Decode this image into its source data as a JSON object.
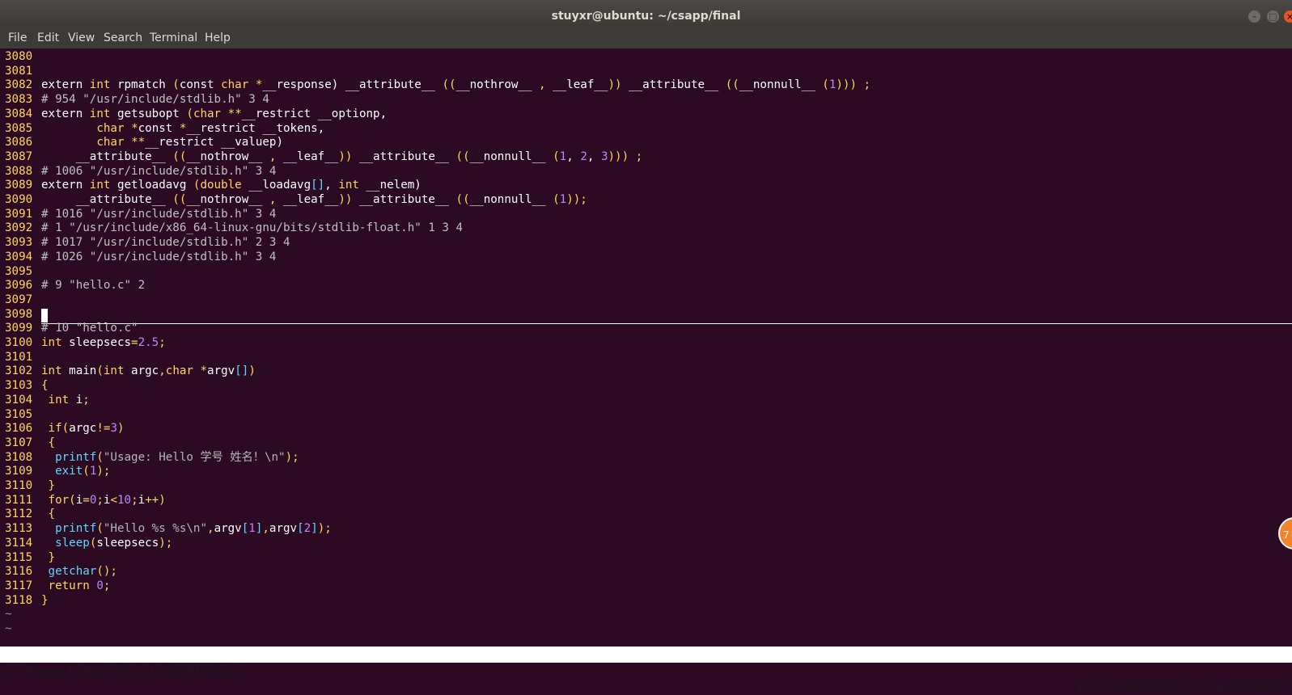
{
  "window": {
    "title": "stuyxr@ubuntu: ~/csapp/final",
    "buttons": {
      "minimize": "–",
      "maximize": "□",
      "close": "×"
    }
  },
  "menu": [
    "File",
    "Edit",
    "View",
    "Search",
    "Terminal",
    "Help"
  ],
  "editor": {
    "lines": [
      {
        "n": "3080",
        "t": []
      },
      {
        "n": "3081",
        "t": []
      },
      {
        "n": "3082",
        "t": [
          [
            "extern "
          ],
          [
            "int",
            "kw"
          ],
          [
            " rpmatch "
          ],
          [
            "(",
            "br"
          ],
          [
            "const "
          ],
          [
            "char",
            "kw"
          ],
          [
            " "
          ],
          [
            "*",
            "kw"
          ],
          [
            "__response) "
          ],
          [
            "__attribute__ "
          ],
          [
            "((",
            "br"
          ],
          [
            "__nothrow__ "
          ],
          [
            ",",
            "br"
          ],
          [
            " __leaf__"
          ],
          [
            "))",
            "br"
          ],
          [
            " __attribute__ "
          ],
          [
            "((",
            "br"
          ],
          [
            "__nonnull__ "
          ],
          [
            "(",
            "br"
          ],
          [
            "1",
            "num"
          ],
          [
            ")))",
            "br"
          ],
          [
            " ;",
            "br"
          ]
        ]
      },
      {
        "n": "3083",
        "t": [
          [
            "# 954 \"/usr/include/stdlib.h\" 3 4",
            "cmt"
          ]
        ]
      },
      {
        "n": "3084",
        "t": [
          [
            "extern "
          ],
          [
            "int",
            "kw"
          ],
          [
            " getsubopt "
          ],
          [
            "(",
            "br"
          ],
          [
            "char",
            "kw"
          ],
          [
            " "
          ],
          [
            "**",
            "kw"
          ],
          [
            "__restrict __optionp,"
          ]
        ]
      },
      {
        "n": "3085",
        "t": [
          [
            "        "
          ],
          [
            "char",
            "kw"
          ],
          [
            " "
          ],
          [
            "*",
            "kw"
          ],
          [
            "const "
          ],
          [
            "*",
            "kw"
          ],
          [
            "__restrict __tokens,"
          ]
        ]
      },
      {
        "n": "3086",
        "t": [
          [
            "        "
          ],
          [
            "char",
            "kw"
          ],
          [
            " "
          ],
          [
            "**",
            "kw"
          ],
          [
            "__restrict __valuep)"
          ]
        ]
      },
      {
        "n": "3087",
        "t": [
          [
            "     __attribute__ "
          ],
          [
            "((",
            "br"
          ],
          [
            "__nothrow__ "
          ],
          [
            ",",
            "br"
          ],
          [
            " __leaf__"
          ],
          [
            "))",
            "br"
          ],
          [
            " __attribute__ "
          ],
          [
            "((",
            "br"
          ],
          [
            "__nonnull__ "
          ],
          [
            "(",
            "br"
          ],
          [
            "1",
            "num"
          ],
          [
            ", "
          ],
          [
            "2",
            "num"
          ],
          [
            ", "
          ],
          [
            "3",
            "num"
          ],
          [
            ")))",
            "br"
          ],
          [
            " ;",
            "br"
          ]
        ]
      },
      {
        "n": "3088",
        "t": [
          [
            "# 1006 \"/usr/include/stdlib.h\" 3 4",
            "cmt"
          ]
        ]
      },
      {
        "n": "3089",
        "t": [
          [
            "extern "
          ],
          [
            "int",
            "kw"
          ],
          [
            " getloadavg "
          ],
          [
            "(",
            "br"
          ],
          [
            "double",
            "kw"
          ],
          [
            " __loadavg"
          ],
          [
            "[]",
            "fn"
          ],
          [
            ", "
          ],
          [
            "int",
            "kw"
          ],
          [
            " __nelem)"
          ]
        ]
      },
      {
        "n": "3090",
        "t": [
          [
            "     __attribute__ "
          ],
          [
            "((",
            "br"
          ],
          [
            "__nothrow__ "
          ],
          [
            ",",
            "br"
          ],
          [
            " __leaf__"
          ],
          [
            "))",
            "br"
          ],
          [
            " __attribute__ "
          ],
          [
            "((",
            "br"
          ],
          [
            "__nonnull__ "
          ],
          [
            "(",
            "br"
          ],
          [
            "1",
            "num"
          ],
          [
            "));",
            "br"
          ]
        ]
      },
      {
        "n": "3091",
        "t": [
          [
            "# 1016 \"/usr/include/stdlib.h\" 3 4",
            "cmt"
          ]
        ]
      },
      {
        "n": "3092",
        "t": [
          [
            "# 1 \"/usr/include/x86_64-linux-gnu/bits/stdlib-float.h\" 1 3 4",
            "cmt"
          ]
        ]
      },
      {
        "n": "3093",
        "t": [
          [
            "# 1017 \"/usr/include/stdlib.h\" 2 3 4",
            "cmt"
          ]
        ]
      },
      {
        "n": "3094",
        "t": [
          [
            "# 1026 \"/usr/include/stdlib.h\" 3 4",
            "cmt"
          ]
        ]
      },
      {
        "n": "3095",
        "t": []
      },
      {
        "n": "3096",
        "t": [
          [
            "# 9 \"hello.c\" 2",
            "cmt"
          ]
        ]
      },
      {
        "n": "3097",
        "t": []
      },
      {
        "n": "3098",
        "t": []
      },
      {
        "n": "3099",
        "t": [
          [
            "# 10 \"hello.c\"",
            "cmt"
          ]
        ]
      },
      {
        "n": "3100",
        "t": [
          [
            "int",
            "kw"
          ],
          [
            " sleepsecs"
          ],
          [
            "=",
            "br"
          ],
          [
            "2.5",
            "num"
          ],
          [
            ";",
            "br"
          ]
        ]
      },
      {
        "n": "3101",
        "t": []
      },
      {
        "n": "3102",
        "t": [
          [
            "int",
            "kw"
          ],
          [
            " main"
          ],
          [
            "(",
            "br"
          ],
          [
            "int",
            "kw"
          ],
          [
            " argc"
          ],
          [
            ",",
            "br"
          ],
          [
            "char",
            "kw"
          ],
          [
            " "
          ],
          [
            "*",
            "kw"
          ],
          [
            "argv"
          ],
          [
            "[]",
            "fn"
          ],
          [
            ")",
            "br"
          ]
        ]
      },
      {
        "n": "3103",
        "t": [
          [
            "{",
            "br"
          ]
        ]
      },
      {
        "n": "3104",
        "t": [
          [
            " "
          ],
          [
            "int",
            "kw"
          ],
          [
            " i"
          ],
          [
            ";",
            "br"
          ]
        ]
      },
      {
        "n": "3105",
        "t": []
      },
      {
        "n": "3106",
        "t": [
          [
            " "
          ],
          [
            "if",
            "kw"
          ],
          [
            "(",
            "br"
          ],
          [
            "argc"
          ],
          [
            "!=",
            "br"
          ],
          [
            "3",
            "num"
          ],
          [
            ")",
            "br"
          ]
        ]
      },
      {
        "n": "3107",
        "t": [
          [
            " "
          ],
          [
            "{",
            "br"
          ]
        ]
      },
      {
        "n": "3108",
        "t": [
          [
            "  "
          ],
          [
            "printf",
            "fn"
          ],
          [
            "(",
            "br"
          ],
          [
            "\"Usage: Hello 学号 姓名！\\n\"",
            "str"
          ],
          [
            ");",
            "br"
          ]
        ]
      },
      {
        "n": "3109",
        "t": [
          [
            "  "
          ],
          [
            "exit",
            "fn"
          ],
          [
            "(",
            "br"
          ],
          [
            "1",
            "num"
          ],
          [
            ");",
            "br"
          ]
        ]
      },
      {
        "n": "3110",
        "t": [
          [
            " "
          ],
          [
            "}",
            "br"
          ]
        ]
      },
      {
        "n": "3111",
        "t": [
          [
            " "
          ],
          [
            "for",
            "kw"
          ],
          [
            "(",
            "br"
          ],
          [
            "i"
          ],
          [
            "=",
            "br"
          ],
          [
            "0",
            "num"
          ],
          [
            ";",
            "br"
          ],
          [
            "i"
          ],
          [
            "<",
            "br"
          ],
          [
            "10",
            "num"
          ],
          [
            ";",
            "br"
          ],
          [
            "i"
          ],
          [
            "++)",
            "br"
          ]
        ]
      },
      {
        "n": "3112",
        "t": [
          [
            " "
          ],
          [
            "{",
            "br"
          ]
        ]
      },
      {
        "n": "3113",
        "t": [
          [
            "  "
          ],
          [
            "printf",
            "fn"
          ],
          [
            "(",
            "br"
          ],
          [
            "\"Hello %s %s\\n\"",
            "str"
          ],
          [
            ",",
            "br"
          ],
          [
            "argv"
          ],
          [
            "[",
            "fn"
          ],
          [
            "1",
            "num"
          ],
          [
            "]",
            "fn"
          ],
          [
            ",",
            "br"
          ],
          [
            "argv"
          ],
          [
            "[",
            "fn"
          ],
          [
            "2",
            "num"
          ],
          [
            "]",
            "fn"
          ],
          [
            ");",
            "br"
          ]
        ]
      },
      {
        "n": "3114",
        "t": [
          [
            "  "
          ],
          [
            "sleep",
            "fn"
          ],
          [
            "(",
            "br"
          ],
          [
            "sleepsecs"
          ],
          [
            ");",
            "br"
          ]
        ]
      },
      {
        "n": "3115",
        "t": [
          [
            " "
          ],
          [
            "}",
            "br"
          ]
        ]
      },
      {
        "n": "3116",
        "t": [
          [
            " "
          ],
          [
            "getchar",
            "fn"
          ],
          [
            "();",
            "br"
          ]
        ]
      },
      {
        "n": "3117",
        "t": [
          [
            " "
          ],
          [
            "return",
            "kw"
          ],
          [
            " "
          ],
          [
            "0",
            "num"
          ],
          [
            ";",
            "br"
          ]
        ]
      },
      {
        "n": "3118",
        "t": [
          [
            "}",
            "br"
          ]
        ]
      }
    ],
    "tildes": [
      "~",
      "~"
    ]
  },
  "statusbar": {
    "left": "[~/csapp/final/hello.i][progress]",
    "right": "[Line:3098/3118,Column:0][99%]"
  },
  "floating_icon": "7"
}
